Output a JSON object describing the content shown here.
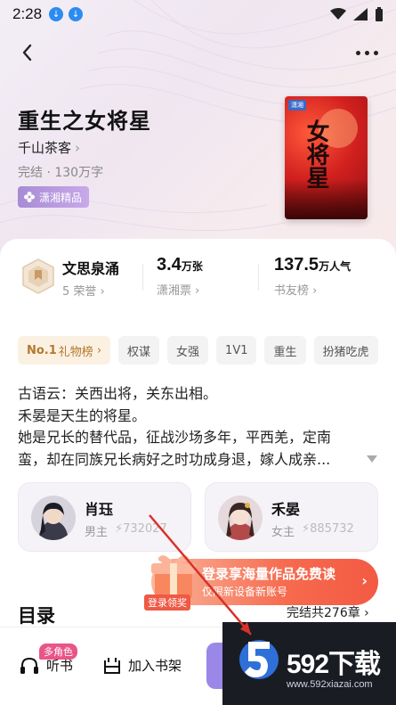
{
  "status_bar": {
    "time": "2:28"
  },
  "book": {
    "title": "重生之女将星",
    "author": "千山茶客",
    "meta": "完结 · 130万字",
    "badge": "潇湘精品",
    "cover_title": "女将星"
  },
  "stats": {
    "honor_name": "文思泉涌",
    "honor_sub": "5 荣誉",
    "tickets_value": "3.4",
    "tickets_unit": "万张",
    "tickets_label": "潇湘票",
    "popularity_value": "137.5",
    "popularity_unit": "万人气",
    "popularity_label": "书友榜"
  },
  "tags": {
    "gift_rank_no": "No.1",
    "gift_rank_label": "礼物榜",
    "items": [
      "权谋",
      "女强",
      "1V1",
      "重生",
      "扮猪吃虎"
    ]
  },
  "synopsis": [
    "古语云：关西出将，关东出相。",
    "禾晏是天生的将星。",
    "她是兄长的替代品，征战沙场多年，平西羌，定南",
    "蛮，却在同族兄长病好之时功成身退，嫁人成亲..."
  ],
  "characters": [
    {
      "name": "肖珏",
      "role": "男主",
      "popularity": "732027"
    },
    {
      "name": "禾晏",
      "role": "女主",
      "popularity": "885732"
    }
  ],
  "promo": {
    "title": "登录享海量作品免费读",
    "subtitle": "仅限新设备新账号",
    "gift_label": "登录领奖"
  },
  "toc": {
    "title": "目录",
    "status": "完结共276章"
  },
  "bottom_bar": {
    "listen_label": "听书",
    "multi_role_badge": "多角色",
    "add_shelf_label": "加入书架"
  },
  "watermark": {
    "brand": "592下载",
    "url": "www.592xiazai.com"
  },
  "colors": {
    "accent": "#9b87e8",
    "promo": "#f35a43",
    "gift": "#b4782e"
  }
}
